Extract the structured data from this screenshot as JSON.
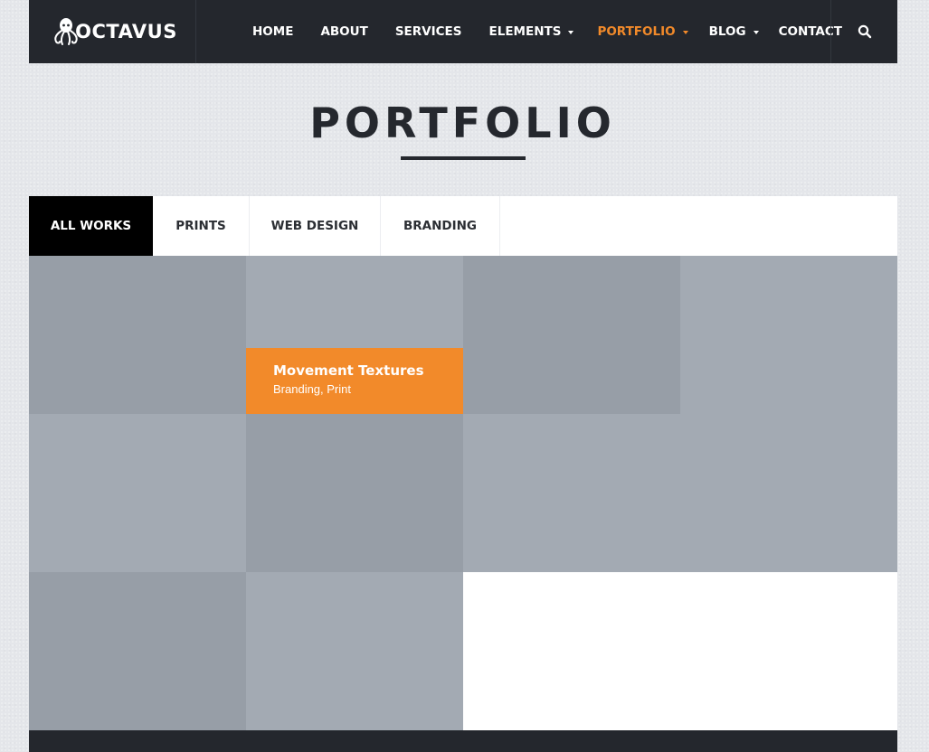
{
  "brand": {
    "logo_text": "OCTAVUS",
    "logo_icon": "octopus-icon"
  },
  "nav": {
    "items": [
      {
        "label": "HOME"
      },
      {
        "label": "ABOUT"
      },
      {
        "label": "SERVICES"
      },
      {
        "label": "ELEMENTS",
        "dropdown": true
      },
      {
        "label": "PORTFOLIO",
        "dropdown": true,
        "active": true
      },
      {
        "label": "BLOG",
        "dropdown": true
      },
      {
        "label": "CONTACT"
      }
    ],
    "search_icon": "search-icon"
  },
  "page": {
    "title": "PORTFOLIO"
  },
  "filters": {
    "tabs": [
      {
        "label": "ALL WORKS",
        "active": true
      },
      {
        "label": "PRINTS"
      },
      {
        "label": "WEB DESIGN"
      },
      {
        "label": "BRANDING"
      }
    ]
  },
  "portfolio": {
    "hover_item": {
      "title": "Movement Textures",
      "tags": "Branding, Print"
    }
  },
  "colors": {
    "accent": "#f28a2a",
    "header_bg": "#24272d",
    "tile_dark": "#979ea7",
    "tile_light": "#a3aab3",
    "active_tab_bg": "#000000",
    "page_bg": "#e4e6ea"
  }
}
